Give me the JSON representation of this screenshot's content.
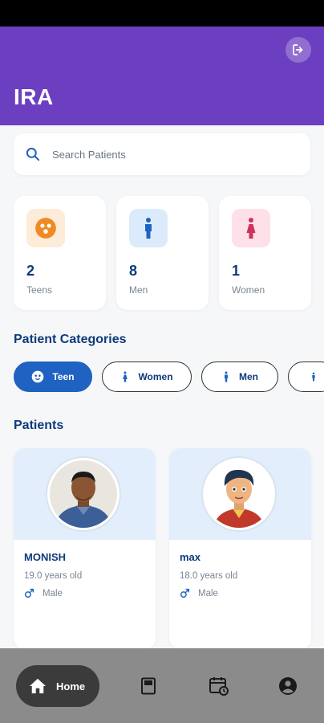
{
  "app": {
    "title": "IRA"
  },
  "search": {
    "placeholder": "Search Patients"
  },
  "stats": [
    {
      "count": "2",
      "label": "Teens",
      "icon": "teen-face-icon",
      "color": "#f08a24",
      "bg": "#fdecd8"
    },
    {
      "count": "8",
      "label": "Men",
      "icon": "male-person-icon",
      "color": "#1f62c2",
      "bg": "#dcebfb"
    },
    {
      "count": "1",
      "label": "Women",
      "icon": "female-person-icon",
      "color": "#d0325f",
      "bg": "#fde0e8"
    }
  ],
  "categories": {
    "title": "Patient Categories",
    "chips": [
      {
        "label": "Teen",
        "icon": "teen-face-icon",
        "active": true
      },
      {
        "label": "Women",
        "icon": "female-person-icon",
        "active": false
      },
      {
        "label": "Men",
        "icon": "male-person-icon",
        "active": false
      }
    ]
  },
  "patients": {
    "title": "Patients",
    "items": [
      {
        "name": "MONISH",
        "age": "19.0 years old",
        "gender": "Male"
      },
      {
        "name": "max",
        "age": "18.0 years old",
        "gender": "Male"
      }
    ]
  },
  "nav": {
    "home_label": "Home"
  },
  "colors": {
    "primary": "#6c3fc0",
    "accent": "#1f62c2",
    "heading": "#0d3b7a"
  }
}
